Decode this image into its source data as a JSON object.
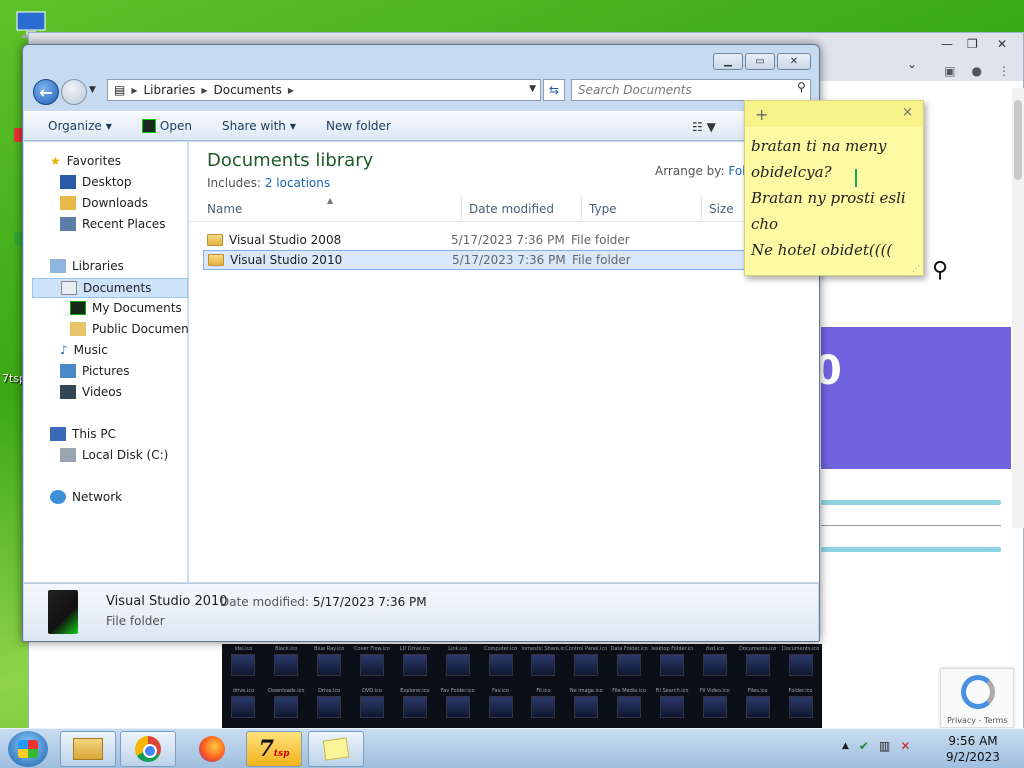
{
  "desktop": {
    "partial_label": "7tsp"
  },
  "explorer": {
    "address": {
      "segments": [
        "Libraries",
        "Documents"
      ]
    },
    "search": {
      "placeholder": "Search Documents"
    },
    "toolbar": {
      "organize": "Organize",
      "open": "Open",
      "share_with": "Share with",
      "new_folder": "New folder"
    },
    "nav": {
      "favorites": "Favorites",
      "desktop": "Desktop",
      "downloads": "Downloads",
      "recent_places": "Recent Places",
      "libraries": "Libraries",
      "documents": "Documents",
      "my_documents": "My Documents",
      "public_documents": "Public Documents",
      "music": "Music",
      "pictures": "Pictures",
      "videos": "Videos",
      "this_pc": "This PC",
      "local_disk": "Local Disk (C:)",
      "network": "Network"
    },
    "library": {
      "title": "Documents library",
      "includes_label": "Includes:",
      "includes_link": "2 locations",
      "arrange_label": "Arrange by:",
      "arrange_value": "Fol"
    },
    "columns": {
      "name": "Name",
      "date_modified": "Date modified",
      "type": "Type",
      "size": "Size"
    },
    "files": [
      {
        "name": "Visual Studio 2008",
        "date": "5/17/2023 7:36 PM",
        "type": "File folder"
      },
      {
        "name": "Visual Studio 2010",
        "date": "5/17/2023 7:36 PM",
        "type": "File folder"
      }
    ],
    "details": {
      "name": "Visual Studio 2010",
      "date_label": "Date modified:",
      "date_value": "5/17/2023 7:36 PM",
      "type": "File folder"
    }
  },
  "sticky": {
    "add": "+",
    "close": "×",
    "lines": [
      "bratan ti na meny",
      "obidelcya?",
      "Bratan ny prosti esli",
      "cho",
      "Ne hotel obidet(((("
    ]
  },
  "browser": {
    "hero_fragment": "0",
    "recaptcha": "Privacy - Terms"
  },
  "gallery": {
    "labels": [
      "Idei.ico",
      "Black.ico",
      "Blue Ray.ico",
      "Cover Flow.ico",
      "LD Drive.ico",
      "Link.ico",
      "Computer.ico",
      "Domestic Share.ico",
      "Control Panel.ico",
      "Data Folder.ico",
      "Desktop Folder.ico",
      "dvd.ico",
      "Documents.ico",
      "Documents.ico",
      "drive.ico",
      "Downloads.ico",
      "Drive.ico",
      "DVD.ico",
      "Explorer.ico",
      "Fav Folder.ico",
      "Fav.ico",
      "Fil.ico",
      "Ne image.ico",
      "File Media.ico",
      "Fil Search.ico",
      "Fil Video.ico",
      "Files.ico",
      "Folder.ico"
    ]
  },
  "taskbar": {
    "time": "9:56 AM",
    "date": "9/2/2023",
    "tsp_label": "7",
    "tsp_sub": "tsp"
  },
  "colors": {
    "library_title": "#1e5a2a",
    "link": "#1a66b8",
    "sticky": "#fdfaa4"
  }
}
